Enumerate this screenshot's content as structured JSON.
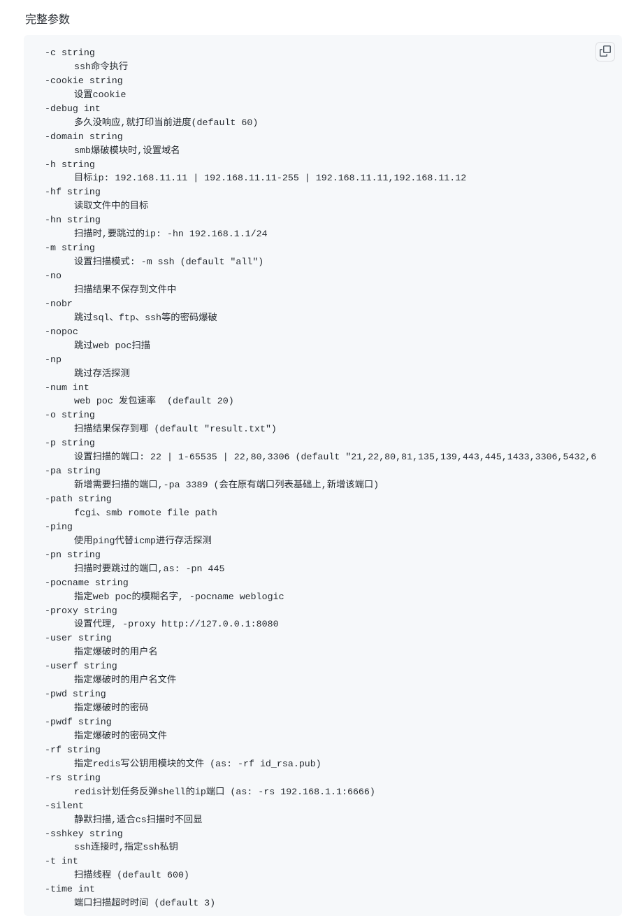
{
  "heading": "完整参数",
  "params": [
    {
      "flag": "-c string",
      "desc": "ssh命令执行"
    },
    {
      "flag": "-cookie string",
      "desc": "设置cookie"
    },
    {
      "flag": "-debug int",
      "desc": "多久没响应,就打印当前进度(default 60)"
    },
    {
      "flag": "-domain string",
      "desc": "smb爆破模块时,设置域名"
    },
    {
      "flag": "-h string",
      "desc": "目标ip: 192.168.11.11 | 192.168.11.11-255 | 192.168.11.11,192.168.11.12"
    },
    {
      "flag": "-hf string",
      "desc": "读取文件中的目标"
    },
    {
      "flag": "-hn string",
      "desc": "扫描时,要跳过的ip: -hn 192.168.1.1/24"
    },
    {
      "flag": "-m string",
      "desc": "设置扫描模式: -m ssh (default \"all\")"
    },
    {
      "flag": "-no",
      "desc": "扫描结果不保存到文件中"
    },
    {
      "flag": "-nobr",
      "desc": "跳过sql、ftp、ssh等的密码爆破"
    },
    {
      "flag": "-nopoc",
      "desc": "跳过web poc扫描"
    },
    {
      "flag": "-np",
      "desc": "跳过存活探测"
    },
    {
      "flag": "-num int",
      "desc": "web poc 发包速率  (default 20)"
    },
    {
      "flag": "-o string",
      "desc": "扫描结果保存到哪 (default \"result.txt\")"
    },
    {
      "flag": "-p string",
      "desc": "设置扫描的端口: 22 | 1-65535 | 22,80,3306 (default \"21,22,80,81,135,139,443,445,1433,3306,5432,6"
    },
    {
      "flag": "-pa string",
      "desc": "新增需要扫描的端口,-pa 3389 (会在原有端口列表基础上,新增该端口)"
    },
    {
      "flag": "-path string",
      "desc": "fcgi、smb romote file path"
    },
    {
      "flag": "-ping",
      "desc": "使用ping代替icmp进行存活探测"
    },
    {
      "flag": "-pn string",
      "desc": "扫描时要跳过的端口,as: -pn 445"
    },
    {
      "flag": "-pocname string",
      "desc": "指定web poc的模糊名字, -pocname weblogic"
    },
    {
      "flag": "-proxy string",
      "desc": "设置代理, -proxy http://127.0.0.1:8080"
    },
    {
      "flag": "-user string",
      "desc": "指定爆破时的用户名"
    },
    {
      "flag": "-userf string",
      "desc": "指定爆破时的用户名文件"
    },
    {
      "flag": "-pwd string",
      "desc": "指定爆破时的密码"
    },
    {
      "flag": "-pwdf string",
      "desc": "指定爆破时的密码文件"
    },
    {
      "flag": "-rf string",
      "desc": "指定redis写公钥用模块的文件 (as: -rf id_rsa.pub)"
    },
    {
      "flag": "-rs string",
      "desc": "redis计划任务反弹shell的ip端口 (as: -rs 192.168.1.1:6666)"
    },
    {
      "flag": "-silent",
      "desc": "静默扫描,适合cs扫描时不回显"
    },
    {
      "flag": "-sshkey string",
      "desc": "ssh连接时,指定ssh私钥"
    },
    {
      "flag": "-t int",
      "desc": "扫描线程 (default 600)"
    },
    {
      "flag": "-time int",
      "desc": "端口扫描超时时间 (default 3)"
    }
  ]
}
